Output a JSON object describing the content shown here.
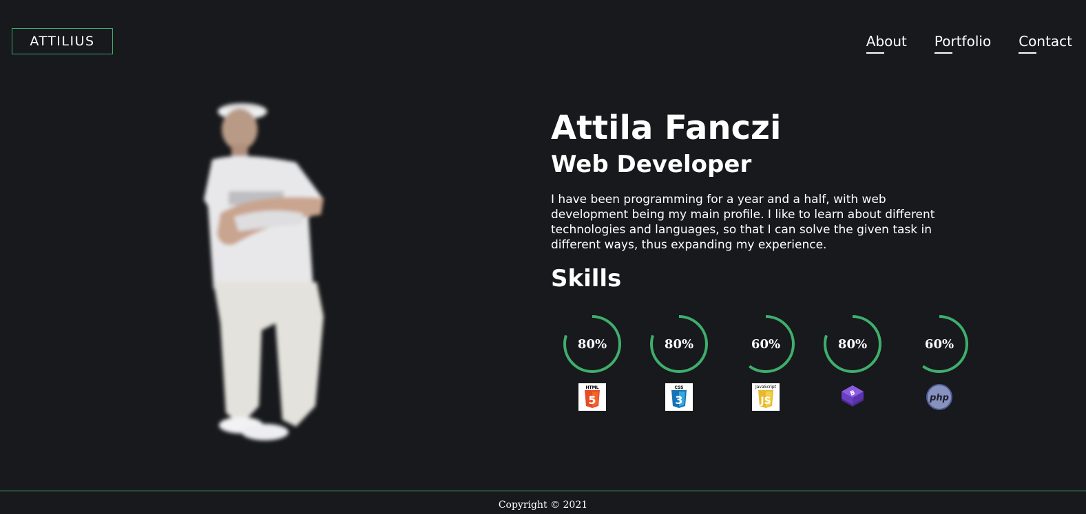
{
  "brand": {
    "logo_text": "ATTILIUS",
    "accent_color": "#3fae6d"
  },
  "nav": {
    "items": [
      {
        "label": "About"
      },
      {
        "label": "Portfolio"
      },
      {
        "label": "Contact"
      }
    ]
  },
  "hero": {
    "name": "Attila Fanczi",
    "role": "Web Developer",
    "bio": "I have been programming for a year and a half, with web development being my main profile. I like to learn about different technologies and languages, so that I can solve the given task in different ways, thus expanding my experience.",
    "skills_title": "Skills"
  },
  "skills": [
    {
      "percent": 80,
      "label": "80%",
      "icon": "html5-icon",
      "icon_text": "HTML"
    },
    {
      "percent": 80,
      "label": "80%",
      "icon": "css3-icon",
      "icon_text": "CSS"
    },
    {
      "percent": 60,
      "label": "60%",
      "icon": "javascript-icon",
      "icon_text": "JavaScript"
    },
    {
      "percent": 80,
      "label": "80%",
      "icon": "bootstrap-icon",
      "icon_text": "B"
    },
    {
      "percent": 60,
      "label": "60%",
      "icon": "php-icon",
      "icon_text": "php"
    }
  ],
  "footer": {
    "copyright": "Copyright © 2021"
  }
}
